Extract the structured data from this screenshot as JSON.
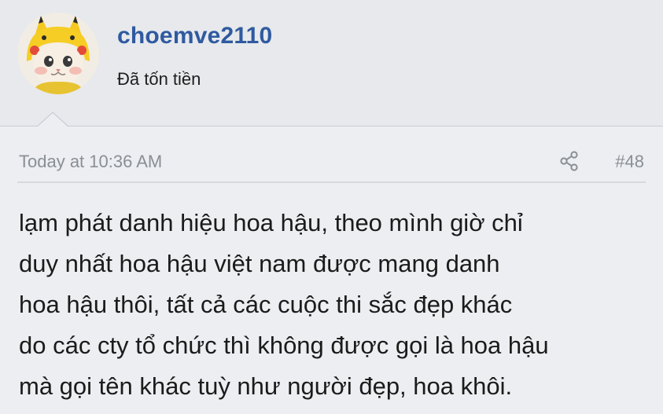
{
  "user": {
    "username": "choemve2110",
    "title": "Đã tốn tiền"
  },
  "post": {
    "timestamp": "Today at 10:36 AM",
    "number": "#48",
    "message_lines": [
      "lạm phát danh hiệu hoa hậu, theo mình giờ chỉ",
      "duy nhất hoa hậu việt nam được mang danh",
      "hoa hậu thôi, tất cả các cuộc thi sắc đẹp khác",
      "do các cty tổ chức thì không được gọi là hoa hậu",
      "mà gọi tên khác tuỳ như người đẹp, hoa khôi."
    ]
  },
  "icons": {
    "share": "share-icon",
    "avatar": "pikachu-hat-cat-avatar"
  },
  "colors": {
    "username": "#2f5aa0",
    "meta_text": "#8a8f96",
    "background": "#eaecef"
  }
}
